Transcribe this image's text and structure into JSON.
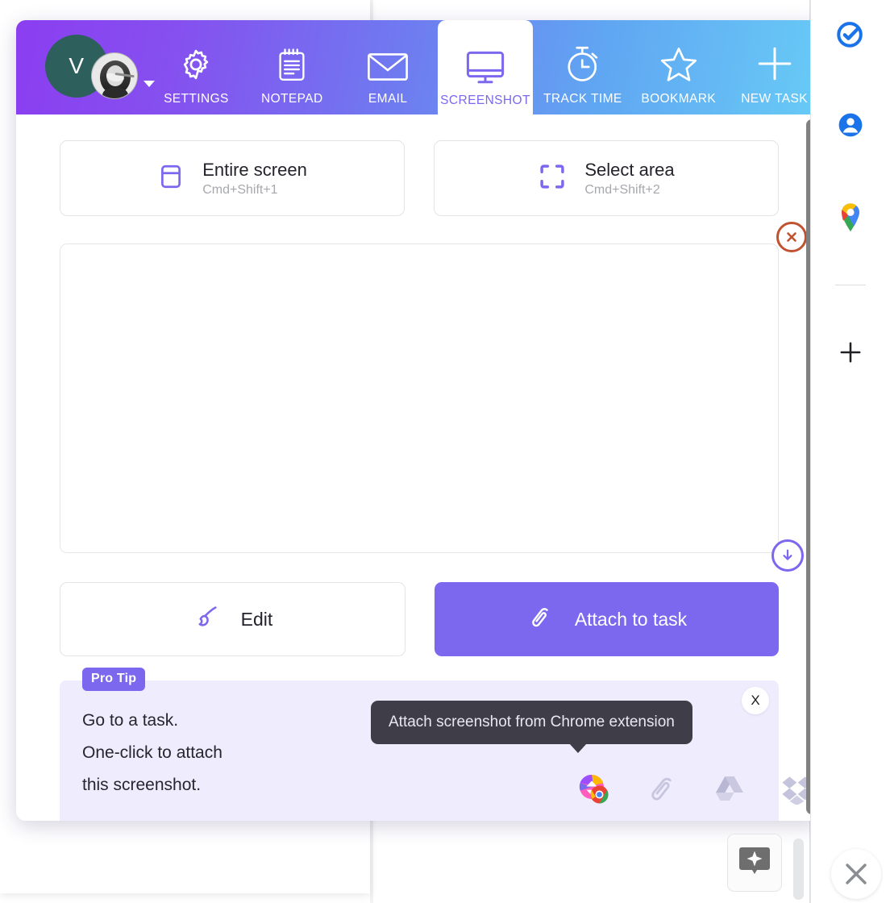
{
  "workspace": {
    "initial": "V",
    "avatar_name": "user-photo-avatar",
    "dropdown_icon": "chevron-down-icon"
  },
  "header": {
    "nav": [
      {
        "label": "SETTINGS",
        "icon": "gear-icon",
        "active": false
      },
      {
        "label": "NOTEPAD",
        "icon": "notepad-icon",
        "active": false
      },
      {
        "label": "EMAIL",
        "icon": "envelope-icon",
        "active": false
      },
      {
        "label": "SCREENSHOT",
        "icon": "monitor-icon",
        "active": true
      },
      {
        "label": "TRACK TIME",
        "icon": "stopwatch-icon",
        "active": false
      },
      {
        "label": "BOOKMARK",
        "icon": "star-icon",
        "active": false
      },
      {
        "label": "NEW TASK",
        "icon": "plus-icon",
        "active": false
      }
    ],
    "gradient_from": "#8b3ef0",
    "gradient_to": "#68cbf6"
  },
  "capture_options": [
    {
      "title": "Entire screen",
      "shortcut": "Cmd+Shift+1",
      "icon": "window-icon"
    },
    {
      "title": "Select area",
      "shortcut": "Cmd+Shift+2",
      "icon": "crop-frame-icon"
    }
  ],
  "preview": {
    "close_label": "✕",
    "close_icon": "circle-x-icon",
    "download_icon": "circle-download-icon"
  },
  "actions": {
    "edit_label": "Edit",
    "edit_icon": "paintbrush-icon",
    "attach_label": "Attach to task",
    "attach_icon": "paperclip-icon",
    "attach_color": "#7b68ee"
  },
  "pro_tip": {
    "badge": "Pro Tip",
    "line1": "Go to a task.",
    "line2": "One-click to attach",
    "line3": "this screenshot.",
    "tooltip": "Attach screenshot from Chrome extension",
    "close_label": "X",
    "icons": [
      {
        "name": "clickup-chrome-logo"
      },
      {
        "name": "paperclip-icon"
      },
      {
        "name": "google-drive-icon"
      },
      {
        "name": "dropbox-icon"
      }
    ]
  },
  "rail": {
    "items": [
      {
        "name": "google-tasks-icon"
      },
      {
        "name": "google-contacts-icon"
      },
      {
        "name": "google-maps-icon"
      }
    ],
    "add_label": "+",
    "add_icon": "plus-icon"
  },
  "bottom": {
    "gemini_icon": "gemini-sparkle-icon",
    "close_icon": "close-x-icon"
  }
}
